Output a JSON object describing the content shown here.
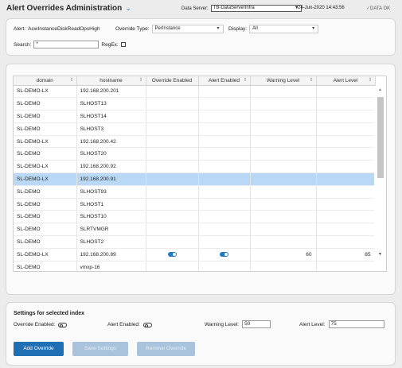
{
  "header": {
    "title": "Alert Overrides Administration",
    "data_server_label": "Data Server:",
    "data_server_value": "TB-DataServerInfra",
    "timestamp": "24-Jun-2020 14:43:56",
    "status": "DATA OK"
  },
  "filters": {
    "alert_label": "Alert:",
    "alert_value": "AcwInstanceDiskReadOpsHigh",
    "override_type_label": "Override Type:",
    "override_type_value": "PerInstance",
    "display_label": "Display:",
    "display_value": "All",
    "search_label": "Search:",
    "search_value": "*",
    "regex_label": "RegEx:"
  },
  "table": {
    "columns": [
      "domain",
      "hostname",
      "Override Enabled",
      "Alert Enabled",
      "Warning Level",
      "Alert Level"
    ],
    "rows": [
      {
        "domain": "SL-DEMO-LX",
        "hostname": "192.168.200.201",
        "override": false,
        "alert": false,
        "warning": "",
        "level": ""
      },
      {
        "domain": "SL-DEMO",
        "hostname": "SLHOST13",
        "override": false,
        "alert": false,
        "warning": "",
        "level": ""
      },
      {
        "domain": "SL-DEMO",
        "hostname": "SLHOST14",
        "override": false,
        "alert": false,
        "warning": "",
        "level": ""
      },
      {
        "domain": "SL-DEMO",
        "hostname": "SLHOST3",
        "override": false,
        "alert": false,
        "warning": "",
        "level": ""
      },
      {
        "domain": "SL-DEMO-LX",
        "hostname": "192.168.200.42",
        "override": false,
        "alert": false,
        "warning": "",
        "level": ""
      },
      {
        "domain": "SL-DEMO",
        "hostname": "SLHOST20",
        "override": false,
        "alert": false,
        "warning": "",
        "level": ""
      },
      {
        "domain": "SL-DEMO-LX",
        "hostname": "192.168.200.92",
        "override": false,
        "alert": false,
        "warning": "",
        "level": ""
      },
      {
        "domain": "SL-DEMO-LX",
        "hostname": "192.168.200.91",
        "override": false,
        "alert": false,
        "warning": "",
        "level": "",
        "selected": true
      },
      {
        "domain": "SL-DEMO",
        "hostname": "SLHOST93",
        "override": false,
        "alert": false,
        "warning": "",
        "level": ""
      },
      {
        "domain": "SL-DEMO",
        "hostname": "SLHOST1",
        "override": false,
        "alert": false,
        "warning": "",
        "level": ""
      },
      {
        "domain": "SL-DEMO",
        "hostname": "SLHOST10",
        "override": false,
        "alert": false,
        "warning": "",
        "level": ""
      },
      {
        "domain": "SL-DEMO",
        "hostname": "SLRTVMGR",
        "override": false,
        "alert": false,
        "warning": "",
        "level": ""
      },
      {
        "domain": "SL-DEMO",
        "hostname": "SLHOST2",
        "override": false,
        "alert": false,
        "warning": "",
        "level": ""
      },
      {
        "domain": "SL-DEMO-LX",
        "hostname": "192.168.200.89",
        "override": true,
        "alert": true,
        "warning": "60",
        "level": "85"
      },
      {
        "domain": "SL-DEMO",
        "hostname": "vmxp-16",
        "override": false,
        "alert": false,
        "warning": "",
        "level": ""
      }
    ]
  },
  "settings": {
    "heading": "Settings for selected index",
    "override_label": "Override Enabled:",
    "alert_enabled_label": "Alert Enabled:",
    "warning_label": "Warning Level:",
    "warning_value": "50",
    "alert_level_label": "Alert Level:",
    "alert_level_value": "75"
  },
  "buttons": {
    "add": "Add Override",
    "save": "Save Settings",
    "remove": "Remove Override"
  },
  "colors": {
    "accent": "#1f6fb5",
    "selected_row": "#b9d8f6",
    "ok": "#3ca03c"
  }
}
